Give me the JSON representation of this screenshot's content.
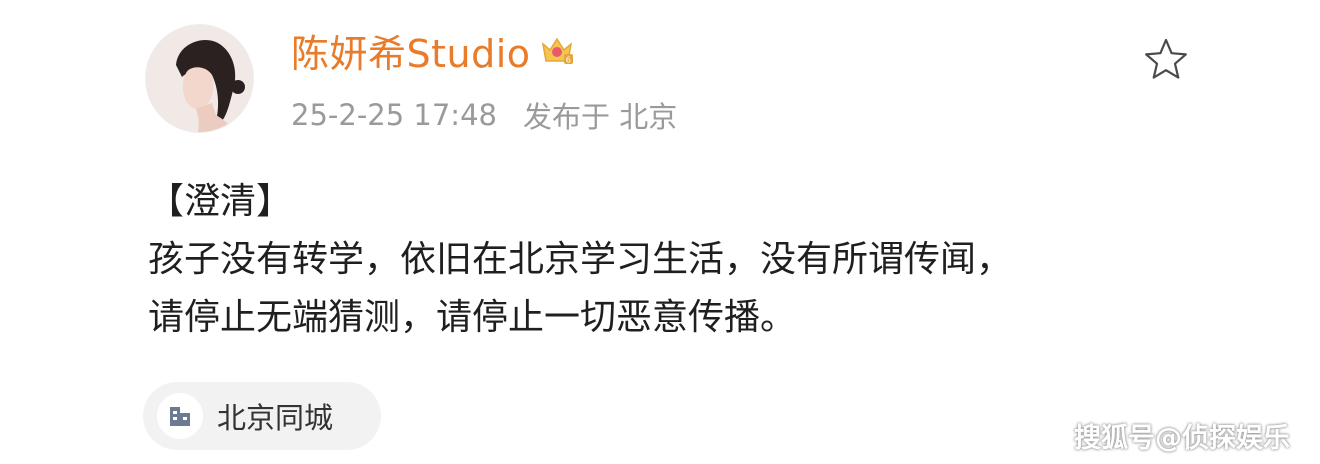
{
  "post": {
    "username": "陈妍希Studio",
    "timestamp": "25-2-25 17:48",
    "location_text": "发布于 北京",
    "content_lines": [
      "【澄清】",
      "孩子没有转学，依旧在北京学习生活，没有所谓传闻，",
      "请停止无端猜测，请停止一切恶意传播。"
    ],
    "location_tag": "北京同城"
  },
  "icons": {
    "avatar": "profile-photo",
    "badge": "crown-badge-icon",
    "favorite": "star-outline-icon",
    "location": "building-icon"
  },
  "watermark": "搜狐号@侦探娱乐",
  "colors": {
    "username": "#e87c2a",
    "meta": "#9a9a9a",
    "content": "#1f1f1f",
    "tag_bg": "#f2f2f2",
    "tag_text": "#333333"
  }
}
